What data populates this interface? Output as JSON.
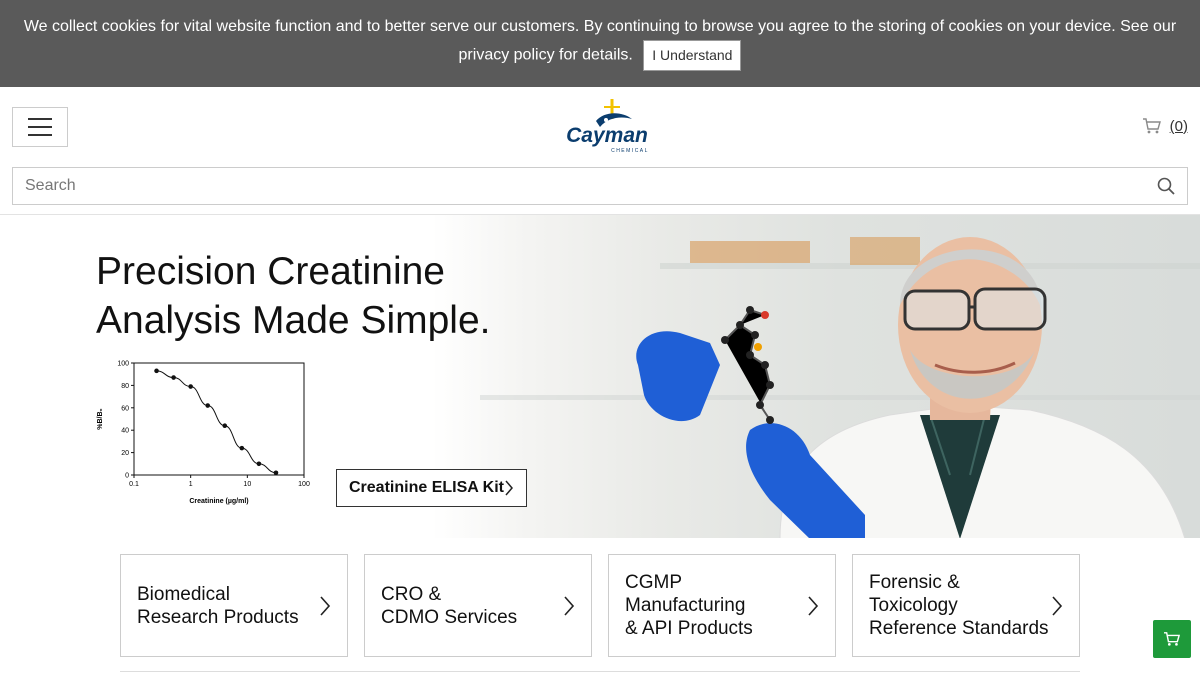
{
  "cookie_banner": {
    "text_line1": "We collect cookies for vital website function and to better serve our customers. By continuing to browse you agree to the storing of cookies on your device. See our",
    "text_line2": "privacy policy for details.",
    "button_label": "I Understand"
  },
  "header": {
    "logo_text": "Cayman",
    "logo_subtext": "CHEMICAL",
    "cart_count": "(0)",
    "search_placeholder": "Search"
  },
  "hero": {
    "headline": "Precision Creatinine Analysis Made Simple.",
    "cta_label": "Creatinine ELISA Kit",
    "chart": {
      "ylabel": "%B/B₀",
      "xlabel": "Creatinine (µg/ml)",
      "y_ticks": [
        "100",
        "80",
        "60",
        "40",
        "20",
        "0"
      ],
      "x_ticks": [
        "0.1",
        "1",
        "10",
        "100"
      ]
    }
  },
  "chart_data": {
    "type": "scatter",
    "title": "",
    "xlabel": "Creatinine (µg/ml)",
    "ylabel": "%B/B₀",
    "xscale": "log",
    "xlim": [
      0.1,
      100
    ],
    "ylim": [
      0,
      100
    ],
    "x": [
      0.25,
      0.5,
      1,
      2,
      4,
      8,
      16,
      32
    ],
    "y": [
      93,
      87,
      79,
      62,
      44,
      24,
      10,
      2
    ],
    "grid": false
  },
  "cards": [
    {
      "label": "Biomedical\nResearch Products"
    },
    {
      "label": "CRO &\nCDMO Services"
    },
    {
      "label": "CGMP\nManufacturing\n& API Products"
    },
    {
      "label": "Forensic &\nToxicology\nReference Standards"
    }
  ],
  "colors": {
    "cookie_bg": "#5a5a5a",
    "logo_blue": "#0b3d6e",
    "logo_yellow": "#f2c200",
    "cart_green": "#1e9a3a",
    "glove_blue": "#1f5fd6"
  },
  "icons": {
    "menu": "hamburger-icon",
    "cart": "cart-icon",
    "search": "search-icon",
    "chevron": "chevron-right-icon",
    "float_cart": "cart-icon"
  }
}
